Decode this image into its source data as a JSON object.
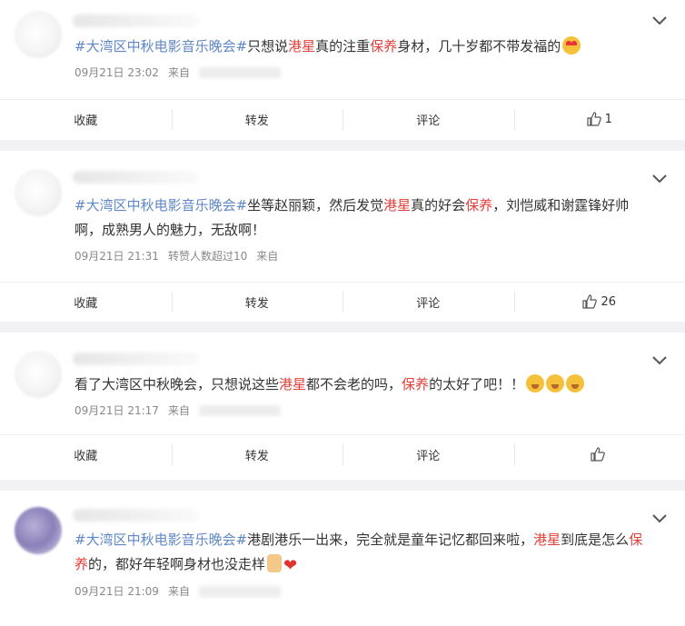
{
  "posts": [
    {
      "segments": [
        {
          "t": "#大湾区中秋电影音乐晚会#",
          "c": "tag"
        },
        {
          "t": "只想说",
          "c": ""
        },
        {
          "t": "港星",
          "c": "hl"
        },
        {
          "t": "真的注重",
          "c": ""
        },
        {
          "t": "保养",
          "c": "hl"
        },
        {
          "t": "身材，几十岁都不带发福的",
          "c": ""
        }
      ],
      "emojis": [
        "love"
      ],
      "time": "09月21日 23:02",
      "extra": "",
      "source": "来自",
      "actions": {
        "fav": "收藏",
        "repost": "转发",
        "comment": "评论",
        "likes": "1"
      }
    },
    {
      "segments": [
        {
          "t": "#大湾区中秋电影音乐晚会#",
          "c": "tag"
        },
        {
          "t": "坐等赵丽颖，然后发觉",
          "c": ""
        },
        {
          "t": "港星",
          "c": "hl"
        },
        {
          "t": "真的好会",
          "c": ""
        },
        {
          "t": "保养",
          "c": "hl"
        },
        {
          "t": "，刘恺威和谢霆锋好帅啊，成熟男人的魅力，无敌啊！",
          "c": ""
        }
      ],
      "emojis": [],
      "time": "09月21日 21:31",
      "extra": "转赞人数超过10",
      "source": "来自",
      "actions": {
        "fav": "收藏",
        "repost": "转发",
        "comment": "评论",
        "likes": "26"
      }
    },
    {
      "segments": [
        {
          "t": "看了大湾区中秋晚会，只想说这些",
          "c": ""
        },
        {
          "t": "港星",
          "c": "hl"
        },
        {
          "t": "都不会老的吗，",
          "c": ""
        },
        {
          "t": "保养",
          "c": "hl"
        },
        {
          "t": "的太好了吧！！",
          "c": ""
        }
      ],
      "emojis": [
        "face",
        "face",
        "face"
      ],
      "time": "09月21日 21:17",
      "extra": "",
      "source": "来自",
      "actions": {
        "fav": "收藏",
        "repost": "转发",
        "comment": "评论",
        "likes": ""
      }
    },
    {
      "segments": [
        {
          "t": "#大湾区中秋电影音乐晚会#",
          "c": "tag"
        },
        {
          "t": "港剧港乐一出来，完全就是童年记忆都回来啦，",
          "c": ""
        },
        {
          "t": "港星",
          "c": "hl"
        },
        {
          "t": "到底是怎么",
          "c": ""
        },
        {
          "t": "保养",
          "c": "hl"
        },
        {
          "t": "的，都好年轻啊身材也没走样",
          "c": ""
        }
      ],
      "emojis": [
        "thumb",
        "heart"
      ],
      "time": "09月21日 21:09",
      "extra": "",
      "source": "来自",
      "actions": null
    }
  ],
  "icons": {
    "more": "chevron-down-icon",
    "like": "thumbs-up-icon"
  },
  "colors": {
    "tag": "#5d87c8",
    "highlight": "#e2403a",
    "background": "#f2f2f5"
  }
}
